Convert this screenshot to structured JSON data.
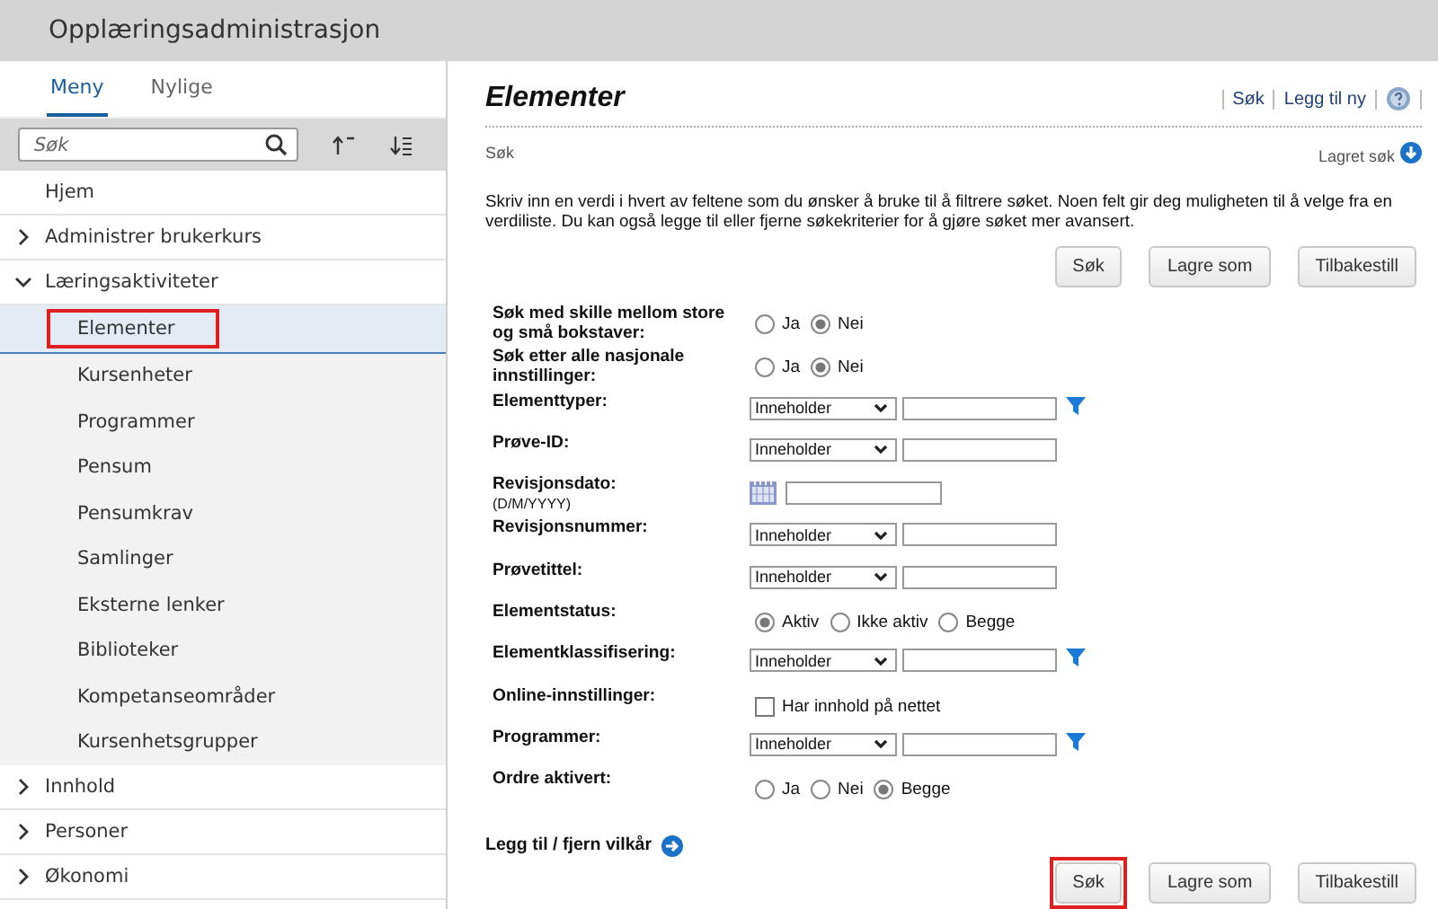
{
  "window": {
    "title": "Opplæringsadministrasjon"
  },
  "sidebar": {
    "tabs": [
      {
        "label": "Meny",
        "selected": true
      },
      {
        "label": "Nylige",
        "selected": false
      }
    ],
    "search": {
      "placeholder": "Søk"
    },
    "items": [
      {
        "label": "Hjem",
        "kind": "leaf"
      },
      {
        "label": "Administrer brukerkurs",
        "kind": "group",
        "expanded": false
      },
      {
        "label": "Læringsaktiviteter",
        "kind": "group",
        "expanded": true,
        "children": [
          {
            "label": "Elementer",
            "selected": true,
            "highlighted": true
          },
          {
            "label": "Kursenheter",
            "selected": false,
            "highlighted": false
          },
          {
            "label": "Programmer",
            "selected": false,
            "highlighted": false
          },
          {
            "label": "Pensum",
            "selected": false,
            "highlighted": false
          },
          {
            "label": "Pensumkrav",
            "selected": false,
            "highlighted": false
          },
          {
            "label": "Samlinger",
            "selected": false,
            "highlighted": false
          },
          {
            "label": "Eksterne lenker",
            "selected": false,
            "highlighted": false
          },
          {
            "label": "Biblioteker",
            "selected": false,
            "highlighted": false
          },
          {
            "label": "Kompetanseområder",
            "selected": false,
            "highlighted": false
          },
          {
            "label": "Kursenhetsgrupper",
            "selected": false,
            "highlighted": false
          }
        ]
      },
      {
        "label": "Innhold",
        "kind": "group",
        "expanded": false
      },
      {
        "label": "Personer",
        "kind": "group",
        "expanded": false
      },
      {
        "label": "Økonomi",
        "kind": "group",
        "expanded": false
      }
    ]
  },
  "main": {
    "title": "Elementer",
    "header_links": [
      "Søk",
      "Legg til ny"
    ],
    "section_label": "Søk",
    "saved_search": "Lagret søk",
    "description": "Skriv inn en verdi i hvert av feltene som du ønsker å bruke til å filtrere søket. Noen felt gir deg muligheten til å velge fra en verdiliste. Du kan også legge til eller fjerne søkekriterier for å gjøre søket mer avansert.",
    "top_buttons": [
      {
        "label": "Søk",
        "highlighted": false
      },
      {
        "label": "Lagre som",
        "highlighted": false
      },
      {
        "label": "Tilbakestill",
        "highlighted": false
      }
    ],
    "fields": [
      {
        "label": "Søk med skille mellom store og små bokstaver:",
        "kind": "radio",
        "options": [
          {
            "label": "Ja",
            "selected": false
          },
          {
            "label": "Nei",
            "selected": true
          }
        ]
      },
      {
        "label": "Søk etter alle nasjonale innstillinger:",
        "kind": "radio",
        "options": [
          {
            "label": "Ja",
            "selected": false
          },
          {
            "label": "Nei",
            "selected": true
          }
        ]
      },
      {
        "label": "Elementtyper:",
        "kind": "select_text",
        "operator": "Inneholder",
        "filter": true
      },
      {
        "label": "Prøve-ID:",
        "kind": "select_text",
        "operator": "Inneholder",
        "filter": false
      },
      {
        "label": "Revisjonsdato:",
        "hint": "(D/M/YYYY)",
        "kind": "date"
      },
      {
        "label": "Revisjonsnummer:",
        "kind": "select_text",
        "operator": "Inneholder",
        "filter": false
      },
      {
        "label": "Prøvetittel:",
        "kind": "select_text",
        "operator": "Inneholder",
        "filter": false
      },
      {
        "label": "Elementstatus:",
        "kind": "radio",
        "options": [
          {
            "label": "Aktiv",
            "selected": true
          },
          {
            "label": "Ikke aktiv",
            "selected": false
          },
          {
            "label": "Begge",
            "selected": false
          }
        ]
      },
      {
        "label": "Elementklassifisering:",
        "kind": "select_text",
        "operator": "Inneholder",
        "filter": true
      },
      {
        "label": "Online-innstillinger:",
        "kind": "checkbox",
        "option": "Har innhold på nettet",
        "checked": false
      },
      {
        "label": "Programmer:",
        "kind": "select_text",
        "operator": "Inneholder",
        "filter": true
      },
      {
        "label": "Ordre aktivert:",
        "kind": "radio",
        "options": [
          {
            "label": "Ja",
            "selected": false
          },
          {
            "label": "Nei",
            "selected": false
          },
          {
            "label": "Begge",
            "selected": true
          }
        ]
      }
    ],
    "add_remove": "Legg til / fjern vilkår",
    "bottom_buttons": [
      {
        "label": "Søk",
        "highlighted": true
      },
      {
        "label": "Lagre som",
        "highlighted": false
      },
      {
        "label": "Tilbakestill",
        "highlighted": false
      }
    ]
  }
}
